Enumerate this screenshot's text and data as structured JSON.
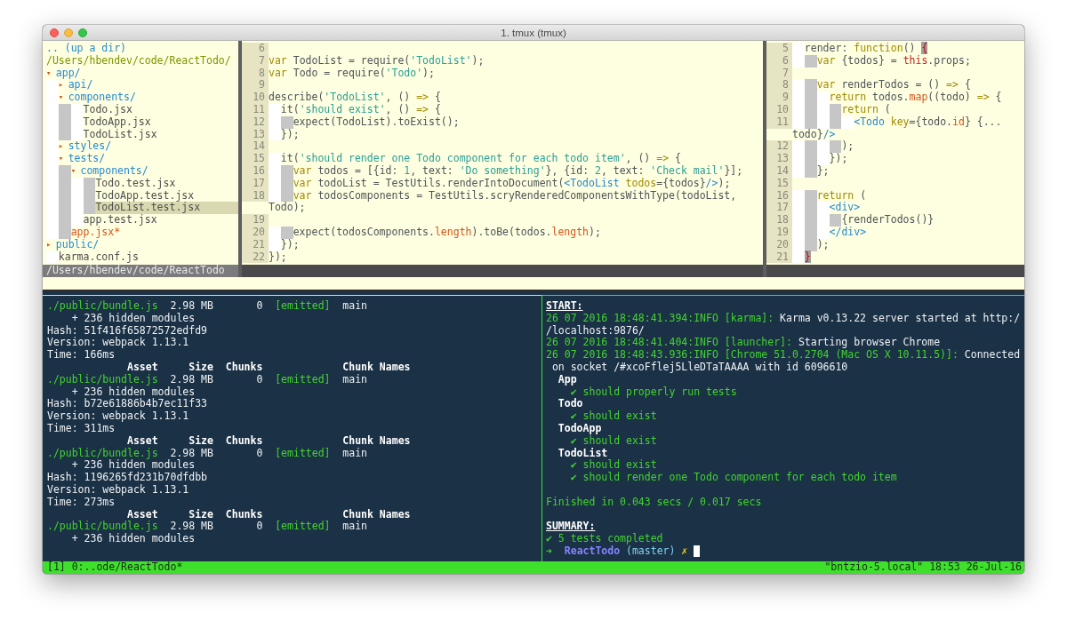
{
  "window": {
    "title": "1. tmux (tmux)"
  },
  "vim": {
    "file_tree": {
      "header": ".. (up a dir)",
      "root": "/Users/hbendev/code/ReactTodo/",
      "status": "/Users/hbendev/code/ReactTodo",
      "nodes": [
        {
          "marker": "▾",
          "name": "app/",
          "kind": "dir",
          "selected": false,
          "children": [
            {
              "marker": "▸",
              "name": "api/",
              "kind": "dir",
              "selected": false
            },
            {
              "marker": "▾",
              "name": "components/",
              "kind": "dir",
              "selected": false,
              "children": [
                {
                  "name": "Todo.jsx",
                  "kind": "file",
                  "selected": false
                },
                {
                  "name": "TodoApp.jsx",
                  "kind": "file",
                  "selected": false
                },
                {
                  "name": "TodoList.jsx",
                  "kind": "file",
                  "selected": false
                }
              ]
            },
            {
              "marker": "▸",
              "name": "styles/",
              "kind": "dir",
              "selected": false
            },
            {
              "marker": "▾",
              "name": "tests/",
              "kind": "dir",
              "selected": false,
              "children": [
                {
                  "marker": "▾",
                  "name": "components/",
                  "kind": "dir",
                  "selected": false,
                  "children": [
                    {
                      "name": "Todo.test.jsx",
                      "kind": "file",
                      "selected": false
                    },
                    {
                      "name": "TodoApp.test.jsx",
                      "kind": "file",
                      "selected": false
                    },
                    {
                      "name": "TodoList.test.jsx",
                      "kind": "file",
                      "selected": true
                    }
                  ]
                },
                {
                  "name": "app.test.jsx",
                  "kind": "file",
                  "selected": false
                }
              ]
            },
            {
              "name": "app.jsx*",
              "kind": "modified",
              "selected": false
            }
          ]
        },
        {
          "marker": "▸",
          "name": "public/",
          "kind": "dir",
          "selected": false
        },
        {
          "name": "karma.conf.js",
          "kind": "file",
          "selected": false
        }
      ]
    },
    "editors": [
      {
        "lines": [
          {
            "num": "6"
          },
          {
            "num": "7",
            "segs": [
              {
                "text": "var",
                "kind": "keyword"
              },
              {
                "text": " TodoList = require(",
                "kind": "plain"
              },
              {
                "text": "'TodoList'",
                "kind": "string"
              },
              {
                "text": ");",
                "kind": "plain"
              }
            ]
          },
          {
            "num": "8",
            "segs": [
              {
                "text": "var",
                "kind": "keyword"
              },
              {
                "text": " Todo = require(",
                "kind": "plain"
              },
              {
                "text": "'Todo'",
                "kind": "string"
              },
              {
                "text": ");",
                "kind": "plain"
              }
            ]
          },
          {
            "num": "9"
          },
          {
            "num": "10",
            "segs": [
              {
                "text": "describe(",
                "kind": "plain"
              },
              {
                "text": "'TodoList'",
                "kind": "string"
              },
              {
                "text": ", () ",
                "kind": "plain"
              },
              {
                "text": "=>",
                "kind": "keyword"
              },
              {
                "text": " {",
                "kind": "plain"
              }
            ]
          },
          {
            "num": "11",
            "segs": [
              {
                "text": "  it(",
                "kind": "plain"
              },
              {
                "text": "'should exist'",
                "kind": "string"
              },
              {
                "text": ", () ",
                "kind": "plain"
              },
              {
                "text": "=>",
                "kind": "keyword"
              },
              {
                "text": " {",
                "kind": "plain"
              }
            ]
          },
          {
            "num": "12",
            "segs": [
              {
                "text": "    expect(TodoList).toExist();",
                "kind": "plain"
              }
            ]
          },
          {
            "num": "13",
            "segs": [
              {
                "text": "  });",
                "kind": "plain"
              }
            ]
          },
          {
            "num": "14"
          },
          {
            "num": "15",
            "segs": [
              {
                "text": "  it(",
                "kind": "plain"
              },
              {
                "text": "'should render one Todo component for each todo item'",
                "kind": "string"
              },
              {
                "text": ", () ",
                "kind": "plain"
              },
              {
                "text": "=>",
                "kind": "keyword"
              },
              {
                "text": " {",
                "kind": "plain"
              }
            ]
          },
          {
            "num": "16",
            "segs": [
              {
                "text": "    var",
                "kind": "keyword"
              },
              {
                "text": " todos = [{id: ",
                "kind": "plain"
              },
              {
                "text": "1",
                "kind": "number"
              },
              {
                "text": ", text: ",
                "kind": "plain"
              },
              {
                "text": "'Do something'",
                "kind": "string"
              },
              {
                "text": "}, {id: ",
                "kind": "plain"
              },
              {
                "text": "2",
                "kind": "number"
              },
              {
                "text": ", text: ",
                "kind": "plain"
              },
              {
                "text": "'Check mail'",
                "kind": "string"
              },
              {
                "text": "}];",
                "kind": "plain"
              }
            ]
          },
          {
            "num": "17",
            "segs": [
              {
                "text": "    var",
                "kind": "keyword"
              },
              {
                "text": " todoList = TestUtils.renderIntoDocument(",
                "kind": "plain"
              },
              {
                "text": "<TodoList",
                "kind": "tag"
              },
              {
                "text": " todos",
                "kind": "attribute"
              },
              {
                "text": "={todos}",
                "kind": "plain"
              },
              {
                "text": "/>",
                "kind": "tag"
              },
              {
                "text": ");",
                "kind": "plain"
              }
            ]
          },
          {
            "num": "18",
            "segs": [
              {
                "text": "    var",
                "kind": "keyword"
              },
              {
                "text": " todosComponents = TestUtils.scryRenderedComponentsWithType(todoList,",
                "kind": "plain"
              }
            ]
          },
          {
            "segs": [
              {
                "text": "Todo);",
                "kind": "plain"
              }
            ]
          },
          {
            "num": "19"
          },
          {
            "num": "20",
            "segs": [
              {
                "text": "    expect(todosComponents.",
                "kind": "plain"
              },
              {
                "text": "length",
                "kind": "property"
              },
              {
                "text": ").toBe(todos.",
                "kind": "plain"
              },
              {
                "text": "length",
                "kind": "property"
              },
              {
                "text": ");",
                "kind": "plain"
              }
            ]
          },
          {
            "num": "21",
            "segs": [
              {
                "text": "  });",
                "kind": "plain"
              }
            ]
          },
          {
            "num": "22",
            "segs": [
              {
                "text": "});",
                "kind": "plain"
              }
            ]
          }
        ]
      },
      {
        "lines": [
          {
            "num": "5",
            "segs": [
              {
                "text": "  render: ",
                "kind": "plain"
              },
              {
                "text": "function",
                "kind": "keyword"
              },
              {
                "text": "() ",
                "kind": "plain"
              },
              {
                "text": "{",
                "kind": "match"
              }
            ]
          },
          {
            "num": "6",
            "segs": [
              {
                "text": "    var",
                "kind": "keyword"
              },
              {
                "text": " {todos} = ",
                "kind": "plain"
              },
              {
                "text": "this",
                "kind": "this"
              },
              {
                "text": ".props;",
                "kind": "plain"
              }
            ]
          },
          {
            "num": "7"
          },
          {
            "num": "8",
            "segs": [
              {
                "text": "    var",
                "kind": "keyword"
              },
              {
                "text": " renderTodos = () ",
                "kind": "plain"
              },
              {
                "text": "=>",
                "kind": "keyword"
              },
              {
                "text": " {",
                "kind": "plain"
              }
            ]
          },
          {
            "num": "9",
            "segs": [
              {
                "text": "      return",
                "kind": "keyword"
              },
              {
                "text": " todos.",
                "kind": "plain"
              },
              {
                "text": "map",
                "kind": "property"
              },
              {
                "text": "((todo) ",
                "kind": "plain"
              },
              {
                "text": "=>",
                "kind": "keyword"
              },
              {
                "text": " {",
                "kind": "plain"
              }
            ]
          },
          {
            "num": "10",
            "segs": [
              {
                "text": "        return",
                "kind": "keyword"
              },
              {
                "text": " (",
                "kind": "plain"
              }
            ]
          },
          {
            "num": "11",
            "segs": [
              {
                "text": "          <Todo",
                "kind": "tag"
              },
              {
                "text": " key",
                "kind": "attribute"
              },
              {
                "text": "={todo.",
                "kind": "plain"
              },
              {
                "text": "id",
                "kind": "property"
              },
              {
                "text": "} {...",
                "kind": "plain"
              }
            ]
          },
          {
            "segs": [
              {
                "text": "todo}",
                "kind": "plain"
              },
              {
                "text": "/>",
                "kind": "tag"
              }
            ]
          },
          {
            "num": "12",
            "segs": [
              {
                "text": "        );",
                "kind": "plain"
              }
            ]
          },
          {
            "num": "13",
            "segs": [
              {
                "text": "      });",
                "kind": "plain"
              }
            ]
          },
          {
            "num": "14",
            "segs": [
              {
                "text": "    };",
                "kind": "plain"
              }
            ]
          },
          {
            "num": "15"
          },
          {
            "num": "16",
            "segs": [
              {
                "text": "    return",
                "kind": "keyword"
              },
              {
                "text": " (",
                "kind": "plain"
              }
            ]
          },
          {
            "num": "17",
            "segs": [
              {
                "text": "      <div>",
                "kind": "tag"
              }
            ]
          },
          {
            "num": "18",
            "segs": [
              {
                "text": "        {renderTodos()}",
                "kind": "plain"
              }
            ]
          },
          {
            "num": "19",
            "segs": [
              {
                "text": "      </div>",
                "kind": "tag"
              }
            ]
          },
          {
            "num": "20",
            "segs": [
              {
                "text": "    );",
                "kind": "plain"
              }
            ]
          },
          {
            "num": "21",
            "segs": [
              {
                "text": "  }",
                "kind": "match"
              }
            ]
          }
        ]
      }
    ]
  },
  "terminal_panes": [
    {
      "active": false,
      "lines": [
        {
          "segs": [
            {
              "text": "./public/bundle.js",
              "kind": "path"
            },
            {
              "text": "  2.98 MB       0  ",
              "kind": "plain"
            },
            {
              "text": "[emitted]",
              "kind": "status"
            },
            {
              "text": "  main",
              "kind": "plain"
            }
          ]
        },
        {
          "segs": [
            {
              "text": "    + 236 hidden modules",
              "kind": "plain"
            }
          ]
        },
        {
          "segs": [
            {
              "text": "Hash: 51f416f65872572edfd9",
              "kind": "plain"
            }
          ]
        },
        {
          "segs": [
            {
              "text": "Version: webpack 1.13.1",
              "kind": "plain"
            }
          ]
        },
        {
          "segs": [
            {
              "text": "Time: 166ms",
              "kind": "plain"
            }
          ]
        },
        {
          "segs": [
            {
              "text": "             Asset     Size  Chunks             Chunk Names",
              "kind": "header"
            }
          ]
        },
        {
          "segs": [
            {
              "text": "./public/bundle.js",
              "kind": "path"
            },
            {
              "text": "  2.98 MB       0  ",
              "kind": "plain"
            },
            {
              "text": "[emitted]",
              "kind": "status"
            },
            {
              "text": "  main",
              "kind": "plain"
            }
          ]
        },
        {
          "segs": [
            {
              "text": "    + 236 hidden modules",
              "kind": "plain"
            }
          ]
        },
        {
          "segs": [
            {
              "text": "Hash: b72e61886b4b7ec11f33",
              "kind": "plain"
            }
          ]
        },
        {
          "segs": [
            {
              "text": "Version: webpack 1.13.1",
              "kind": "plain"
            }
          ]
        },
        {
          "segs": [
            {
              "text": "Time: 311ms",
              "kind": "plain"
            }
          ]
        },
        {
          "segs": [
            {
              "text": "             Asset     Size  Chunks             Chunk Names",
              "kind": "header"
            }
          ]
        },
        {
          "segs": [
            {
              "text": "./public/bundle.js",
              "kind": "path"
            },
            {
              "text": "  2.98 MB       0  ",
              "kind": "plain"
            },
            {
              "text": "[emitted]",
              "kind": "status"
            },
            {
              "text": "  main",
              "kind": "plain"
            }
          ]
        },
        {
          "segs": [
            {
              "text": "    + 236 hidden modules",
              "kind": "plain"
            }
          ]
        },
        {
          "segs": [
            {
              "text": "Hash: 1196265fd231b70dfdbb",
              "kind": "plain"
            }
          ]
        },
        {
          "segs": [
            {
              "text": "Version: webpack 1.13.1",
              "kind": "plain"
            }
          ]
        },
        {
          "segs": [
            {
              "text": "Time: 273ms",
              "kind": "plain"
            }
          ]
        },
        {
          "segs": [
            {
              "text": "             Asset     Size  Chunks             Chunk Names",
              "kind": "header"
            }
          ]
        },
        {
          "segs": [
            {
              "text": "./public/bundle.js",
              "kind": "path"
            },
            {
              "text": "  2.98 MB       0  ",
              "kind": "plain"
            },
            {
              "text": "[emitted]",
              "kind": "status"
            },
            {
              "text": "  main",
              "kind": "plain"
            }
          ]
        },
        {
          "segs": [
            {
              "text": "    + 236 hidden modules",
              "kind": "plain"
            }
          ]
        }
      ]
    },
    {
      "active": true,
      "cursor": true,
      "lines": [
        {
          "segs": [
            {
              "text": "START:",
              "kind": "label"
            }
          ]
        },
        {
          "segs": [
            {
              "text": "26 07 2016 18:48:41.394:INFO [karma]:",
              "kind": "log"
            },
            {
              "text": " Karma v0.13.22 server started at http:/",
              "kind": "plain"
            }
          ]
        },
        {
          "segs": [
            {
              "text": "/localhost:9876/",
              "kind": "plain"
            }
          ]
        },
        {
          "segs": [
            {
              "text": "26 07 2016 18:48:41.404:INFO [launcher]:",
              "kind": "log"
            },
            {
              "text": " Starting browser Chrome",
              "kind": "plain"
            }
          ]
        },
        {
          "segs": [
            {
              "text": "26 07 2016 18:48:43.936:INFO [Chrome 51.0.2704 (Mac OS X 10.11.5)]:",
              "kind": "log"
            },
            {
              "text": " Connected",
              "kind": "plain"
            }
          ]
        },
        {
          "segs": [
            {
              "text": " on socket /#xcoFflej5LleDTaTAAAA with id 6096610",
              "kind": "plain"
            }
          ]
        },
        {
          "segs": [
            {
              "text": "  App",
              "kind": "suite"
            }
          ]
        },
        {
          "segs": [
            {
              "text": "    ✔ should properly run tests",
              "kind": "pass"
            }
          ]
        },
        {
          "segs": [
            {
              "text": "  Todo",
              "kind": "suite"
            }
          ]
        },
        {
          "segs": [
            {
              "text": "    ✔ should exist",
              "kind": "pass"
            }
          ]
        },
        {
          "segs": [
            {
              "text": "  TodoApp",
              "kind": "suite"
            }
          ]
        },
        {
          "segs": [
            {
              "text": "    ✔ should exist",
              "kind": "pass"
            }
          ]
        },
        {
          "segs": [
            {
              "text": "  TodoList",
              "kind": "suite"
            }
          ]
        },
        {
          "segs": [
            {
              "text": "    ✔ should exist",
              "kind": "pass"
            }
          ]
        },
        {
          "segs": [
            {
              "text": "    ✔ should render one Todo component for each todo item",
              "kind": "pass"
            }
          ]
        },
        {
          "blank_before": true,
          "segs": [
            {
              "text": "Finished in 0.043 secs / 0.017 secs",
              "kind": "pass"
            }
          ]
        },
        {
          "blank_before": true,
          "segs": [
            {
              "text": "SUMMARY:",
              "kind": "label"
            }
          ]
        },
        {
          "segs": [
            {
              "text": "✔ 5 tests completed",
              "kind": "pass"
            }
          ]
        },
        {
          "segs": [
            {
              "text": "➜  ",
              "kind": "prompt"
            },
            {
              "text": "ReactTodo",
              "kind": "repo"
            },
            {
              "text": " (master)",
              "kind": "branch"
            },
            {
              "text": " ✗",
              "kind": "dirty"
            }
          ]
        }
      ]
    }
  ],
  "status_bar": {
    "left": "[1] 0:..ode/ReactTodo*",
    "right": "\"bntzio-5.local\" 18:53 26-Jul-16"
  }
}
